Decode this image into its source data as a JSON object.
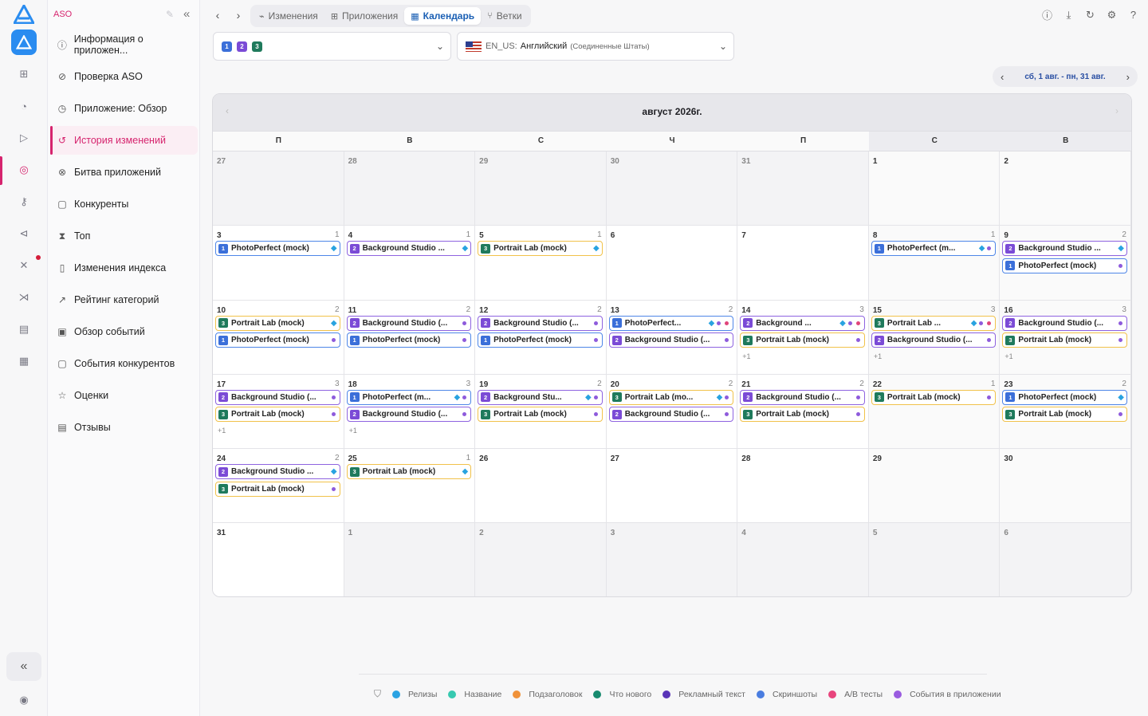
{
  "sidebar": {
    "title": "ASO",
    "items": [
      {
        "label": "Информация о приложен...",
        "icon": "info-icon"
      },
      {
        "label": "Проверка ASO",
        "icon": "check-circle-icon"
      },
      {
        "label": "Приложение: Обзор",
        "icon": "overview-icon"
      },
      {
        "label": "История изменений",
        "icon": "history-icon",
        "active": true
      },
      {
        "label": "Битва приложений",
        "icon": "battle-icon"
      },
      {
        "label": "Конкуренты",
        "icon": "competitors-icon"
      },
      {
        "label": "Топ",
        "icon": "trophy-icon"
      },
      {
        "label": "Изменения индекса",
        "icon": "phone-icon"
      },
      {
        "label": "Рейтинг категорий",
        "icon": "trend-icon"
      },
      {
        "label": "Обзор событий",
        "icon": "calendar-icon"
      },
      {
        "label": "События конкурентов",
        "icon": "competitor-events-icon"
      },
      {
        "label": "Оценки",
        "icon": "star-icon"
      },
      {
        "label": "Отзывы",
        "icon": "reviews-icon"
      }
    ]
  },
  "tabs": [
    {
      "label": "Изменения",
      "icon": "chart-icon"
    },
    {
      "label": "Приложения",
      "icon": "apps-icon"
    },
    {
      "label": "Календарь",
      "icon": "calendar-icon",
      "active": true
    },
    {
      "label": "Ветки",
      "icon": "branch-icon"
    }
  ],
  "app_selector": {
    "badges": [
      "1",
      "2",
      "3"
    ]
  },
  "locale_selector": {
    "code": "EN_US:",
    "language": "Английский",
    "region": "(Соединенные Штаты)"
  },
  "date_range": "сб, 1 авг. - пн, 31 авг.",
  "calendar": {
    "title": "август 2026г.",
    "weekdays": [
      "П",
      "В",
      "С",
      "Ч",
      "П",
      "С",
      "В"
    ],
    "weeks": [
      [
        {
          "day": "27",
          "out": true
        },
        {
          "day": "28",
          "out": true
        },
        {
          "day": "29",
          "out": true
        },
        {
          "day": "30",
          "out": true
        },
        {
          "day": "31",
          "out": true
        },
        {
          "day": "1"
        },
        {
          "day": "2"
        }
      ],
      [
        {
          "day": "3",
          "count": "1",
          "events": [
            {
              "n": "1",
              "name": "PhotoPerfect (mock)",
              "c": "blue",
              "bird": true
            }
          ]
        },
        {
          "day": "4",
          "count": "1",
          "events": [
            {
              "n": "2",
              "name": "Background Studio ...",
              "c": "purple",
              "bird": true
            }
          ]
        },
        {
          "day": "5",
          "count": "1",
          "events": [
            {
              "n": "3",
              "name": "Portrait Lab (mock)",
              "c": "yellow",
              "bird": true
            }
          ]
        },
        {
          "day": "6"
        },
        {
          "day": "7"
        },
        {
          "day": "8",
          "count": "1",
          "events": [
            {
              "n": "1",
              "name": "PhotoPerfect (m...",
              "c": "blue",
              "bird": true,
              "dots": [
                "#8e5bdc"
              ]
            }
          ]
        },
        {
          "day": "9",
          "count": "2",
          "events": [
            {
              "n": "2",
              "name": "Background Studio ...",
              "c": "purple",
              "bird": true
            },
            {
              "n": "1",
              "name": "PhotoPerfect (mock)",
              "c": "blue",
              "dots": [
                "#8e5bdc"
              ]
            }
          ]
        }
      ],
      [
        {
          "day": "10",
          "count": "2",
          "events": [
            {
              "n": "3",
              "name": "Portrait Lab (mock)",
              "c": "yellow",
              "bird": true
            },
            {
              "n": "1",
              "name": "PhotoPerfect (mock)",
              "c": "blue",
              "dots": [
                "#8e5bdc"
              ]
            }
          ]
        },
        {
          "day": "11",
          "count": "2",
          "events": [
            {
              "n": "2",
              "name": "Background Studio (...",
              "c": "purple",
              "dots": [
                "#8e5bdc"
              ]
            },
            {
              "n": "1",
              "name": "PhotoPerfect (mock)",
              "c": "blue",
              "dots": [
                "#8e5bdc"
              ]
            }
          ]
        },
        {
          "day": "12",
          "count": "2",
          "events": [
            {
              "n": "2",
              "name": "Background Studio (...",
              "c": "purple",
              "dots": [
                "#8e5bdc"
              ]
            },
            {
              "n": "1",
              "name": "PhotoPerfect (mock)",
              "c": "blue",
              "dots": [
                "#8e5bdc"
              ]
            }
          ]
        },
        {
          "day": "13",
          "count": "2",
          "events": [
            {
              "n": "1",
              "name": "PhotoPerfect...",
              "c": "blue",
              "bird": true,
              "dots": [
                "#8e5bdc",
                "#e0457b"
              ]
            },
            {
              "n": "2",
              "name": "Background Studio (...",
              "c": "purple",
              "dots": [
                "#8e5bdc"
              ]
            }
          ]
        },
        {
          "day": "14",
          "count": "3",
          "more": "+1",
          "events": [
            {
              "n": "2",
              "name": "Background ...",
              "c": "purple",
              "bird": true,
              "dots": [
                "#8e5bdc",
                "#e0457b"
              ]
            },
            {
              "n": "3",
              "name": "Portrait Lab (mock)",
              "c": "yellow",
              "dots": [
                "#8e5bdc"
              ]
            }
          ]
        },
        {
          "day": "15",
          "count": "3",
          "more": "+1",
          "events": [
            {
              "n": "3",
              "name": "Portrait Lab ...",
              "c": "yellow",
              "bird": true,
              "dots": [
                "#8e5bdc",
                "#e0457b"
              ]
            },
            {
              "n": "2",
              "name": "Background Studio (...",
              "c": "purple",
              "dots": [
                "#8e5bdc"
              ]
            }
          ]
        },
        {
          "day": "16",
          "count": "3",
          "more": "+1",
          "events": [
            {
              "n": "2",
              "name": "Background Studio (...",
              "c": "purple",
              "dots": [
                "#8e5bdc"
              ]
            },
            {
              "n": "3",
              "name": "Portrait Lab (mock)",
              "c": "yellow",
              "dots": [
                "#8e5bdc"
              ]
            }
          ]
        }
      ],
      [
        {
          "day": "17",
          "count": "3",
          "more": "+1",
          "events": [
            {
              "n": "2",
              "name": "Background Studio (...",
              "c": "purple",
              "dots": [
                "#8e5bdc"
              ]
            },
            {
              "n": "3",
              "name": "Portrait Lab (mock)",
              "c": "yellow",
              "dots": [
                "#8e5bdc"
              ]
            }
          ]
        },
        {
          "day": "18",
          "count": "3",
          "more": "+1",
          "events": [
            {
              "n": "1",
              "name": "PhotoPerfect (m...",
              "c": "blue",
              "bird": true,
              "dots": [
                "#8e5bdc"
              ]
            },
            {
              "n": "2",
              "name": "Background Studio (...",
              "c": "purple",
              "dots": [
                "#8e5bdc"
              ]
            }
          ]
        },
        {
          "day": "19",
          "count": "2",
          "events": [
            {
              "n": "2",
              "name": "Background Stu...",
              "c": "purple",
              "bird": true,
              "dots": [
                "#8e5bdc"
              ]
            },
            {
              "n": "3",
              "name": "Portrait Lab (mock)",
              "c": "yellow",
              "dots": [
                "#8e5bdc"
              ]
            }
          ]
        },
        {
          "day": "20",
          "count": "2",
          "events": [
            {
              "n": "3",
              "name": "Portrait Lab (mo...",
              "c": "yellow",
              "bird": true,
              "dots": [
                "#8e5bdc"
              ]
            },
            {
              "n": "2",
              "name": "Background Studio (...",
              "c": "purple",
              "dots": [
                "#8e5bdc"
              ]
            }
          ]
        },
        {
          "day": "21",
          "count": "2",
          "events": [
            {
              "n": "2",
              "name": "Background Studio (...",
              "c": "purple",
              "dots": [
                "#8e5bdc"
              ]
            },
            {
              "n": "3",
              "name": "Portrait Lab (mock)",
              "c": "yellow",
              "dots": [
                "#8e5bdc"
              ]
            }
          ]
        },
        {
          "day": "22",
          "count": "1",
          "events": [
            {
              "n": "3",
              "name": "Portrait Lab (mock)",
              "c": "yellow",
              "dots": [
                "#8e5bdc"
              ]
            }
          ]
        },
        {
          "day": "23",
          "count": "2",
          "events": [
            {
              "n": "1",
              "name": "PhotoPerfect (mock)",
              "c": "blue",
              "bird": true
            },
            {
              "n": "3",
              "name": "Portrait Lab (mock)",
              "c": "yellow",
              "dots": [
                "#8e5bdc"
              ]
            }
          ]
        }
      ],
      [
        {
          "day": "24",
          "count": "2",
          "events": [
            {
              "n": "2",
              "name": "Background Studio ...",
              "c": "purple",
              "bird": true
            },
            {
              "n": "3",
              "name": "Portrait Lab (mock)",
              "c": "yellow",
              "dots": [
                "#8e5bdc"
              ]
            }
          ]
        },
        {
          "day": "25",
          "count": "1",
          "events": [
            {
              "n": "3",
              "name": "Portrait Lab (mock)",
              "c": "yellow",
              "bird": true
            }
          ]
        },
        {
          "day": "26"
        },
        {
          "day": "27"
        },
        {
          "day": "28"
        },
        {
          "day": "29"
        },
        {
          "day": "30"
        }
      ],
      [
        {
          "day": "31"
        },
        {
          "day": "1",
          "out": true
        },
        {
          "day": "2",
          "out": true
        },
        {
          "day": "3",
          "out": true
        },
        {
          "day": "4",
          "out": true
        },
        {
          "day": "5",
          "out": true
        },
        {
          "day": "6",
          "out": true
        }
      ]
    ]
  },
  "legend": [
    {
      "label": "Релизы",
      "color": "#2ba3e3"
    },
    {
      "label": "Название",
      "color": "#37c9b0"
    },
    {
      "label": "Подзаголовок",
      "color": "#f0923a"
    },
    {
      "label": "Что нового",
      "color": "#178a6e"
    },
    {
      "label": "Рекламный текст",
      "color": "#5a34b8"
    },
    {
      "label": "Скриншоты",
      "color": "#4a7de0"
    },
    {
      "label": "A/B тесты",
      "color": "#e8457d"
    },
    {
      "label": "События в приложении",
      "color": "#9a5ce0"
    }
  ],
  "colors": {
    "accent": "#d6246e",
    "blue": "#4e86e8",
    "purple": "#8e63e0",
    "yellow": "#f1c24a",
    "teal": "#2fa88e"
  }
}
